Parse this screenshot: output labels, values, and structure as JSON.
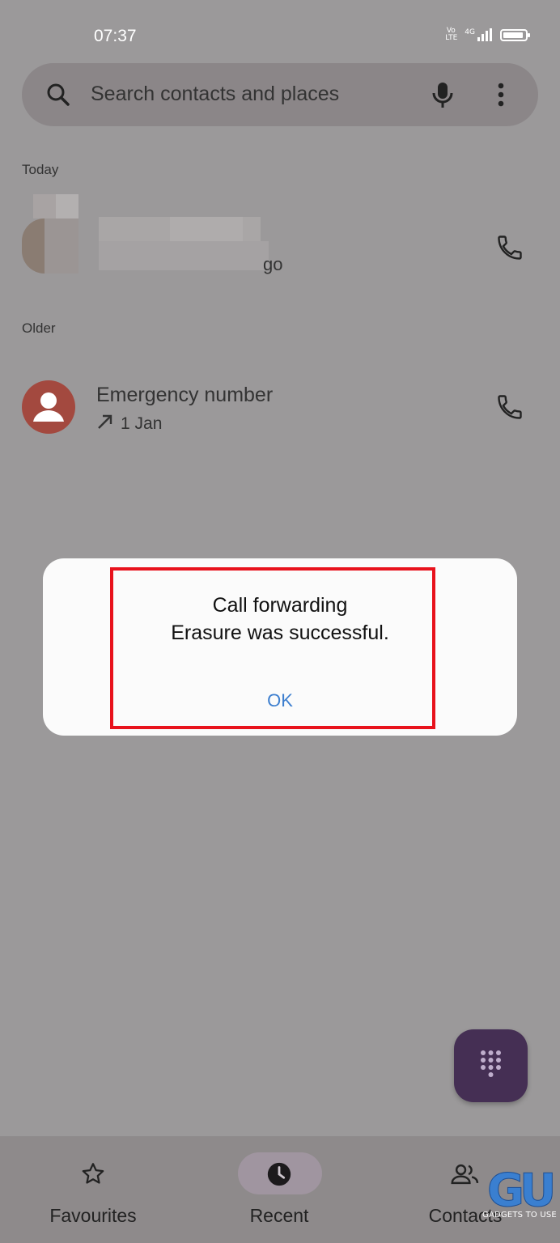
{
  "status_bar": {
    "time": "07:37",
    "network_label": "4G",
    "volte_label": "Vo LTE"
  },
  "search": {
    "placeholder": "Search contacts and places"
  },
  "sections": {
    "today": "Today",
    "older": "Older"
  },
  "calls": [
    {
      "name": "",
      "meta_suffix": "go"
    },
    {
      "name": "Emergency number",
      "date": "1 Jan"
    }
  ],
  "dialog": {
    "title": "Call forwarding",
    "message": "Erasure was successful.",
    "ok_label": "OK"
  },
  "nav": {
    "favourites": "Favourites",
    "recent": "Recent",
    "contacts": "Contacts"
  },
  "watermark": {
    "text": "GADGETS TO USE",
    "logo": "GU"
  },
  "colors": {
    "accent": "#3d7fcf",
    "highlight": "#e8121c",
    "fab": "#452f54",
    "avatar": "#a3493f"
  }
}
